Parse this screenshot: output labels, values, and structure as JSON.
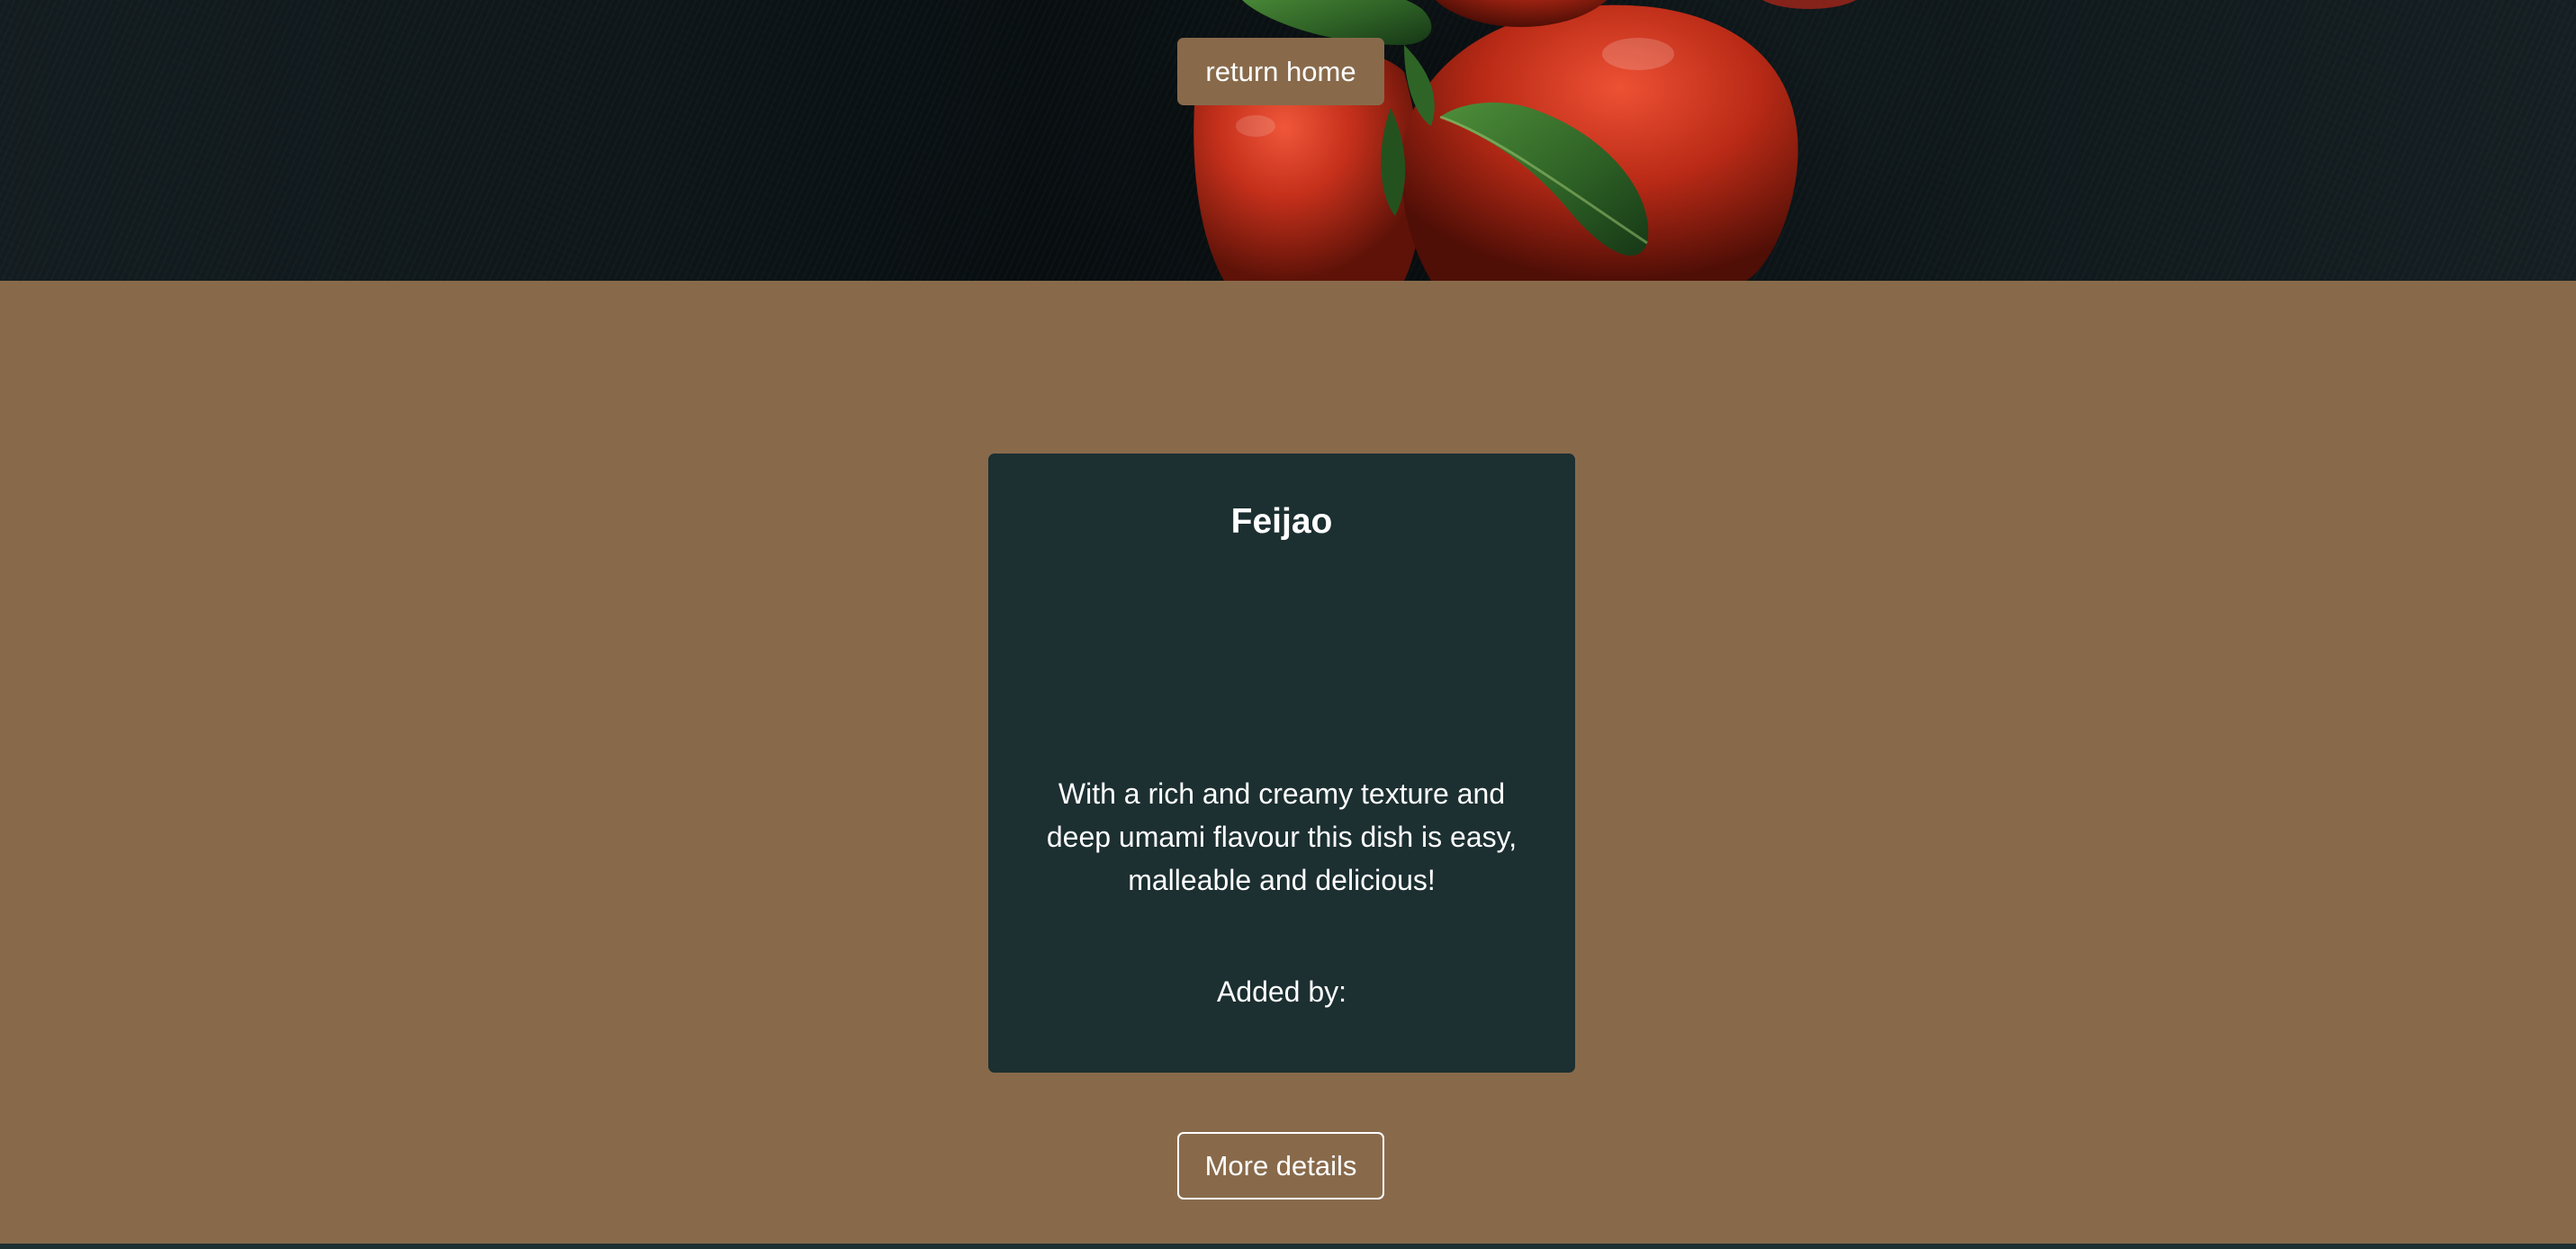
{
  "hero": {
    "image": "tomatoes-and-basil-on-slate",
    "return_home_label": "return home"
  },
  "recipe_card": {
    "title": "Feijao",
    "description": "With a rich and creamy texture and deep umami flavour this dish is easy, malleable and delicious!",
    "added_by_label": "Added by:",
    "more_details_label": "More details"
  },
  "colors": {
    "brand_brown": "#886a4b",
    "card_dark_teal": "#1c2f31",
    "text_white": "#ffffff"
  }
}
